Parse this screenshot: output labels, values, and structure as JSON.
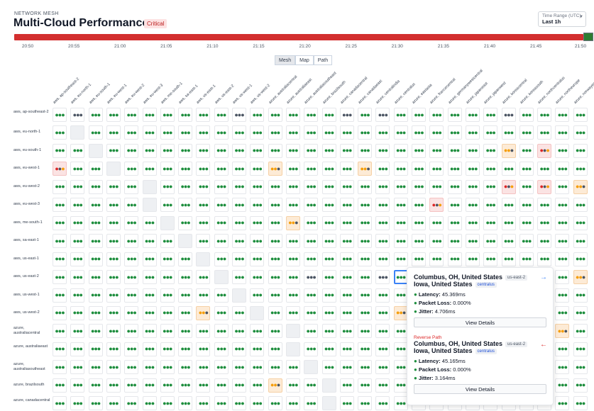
{
  "header": {
    "eyebrow": "NETWORK MESH",
    "title": "Multi-Cloud Performance",
    "status_badge": "Critical",
    "time_range_label": "Time Range (UTC)",
    "time_range_value": "Last 1h"
  },
  "colors": {
    "critical": "#d32f2f",
    "good": "#1e8e3e",
    "warn": "#f59e0b",
    "selected": "#3b82f6"
  },
  "timeline": {
    "ticks": [
      "20:50",
      "20:55",
      "21:00",
      "21:05",
      "21:10",
      "21:15",
      "21:20",
      "21:25",
      "21:30",
      "21:35",
      "21:40",
      "21:45",
      "21:50"
    ]
  },
  "view_tabs": [
    "Mesh",
    "Map",
    "Path"
  ],
  "active_view": "Mesh",
  "columns": [
    "aws, ap-southeast-2",
    "aws, eu-north-1",
    "aws, eu-south-1",
    "aws, eu-west-1",
    "aws, eu-west-2",
    "aws, eu-west-3",
    "aws, me-south-1",
    "aws, sa-east-1",
    "aws, us-east-1",
    "aws, us-east-2",
    "aws, us-west-1",
    "aws, us-west-2",
    "azure, australiacentral",
    "azure, australiaeast",
    "azure, australiasoutheast",
    "azure, brazilsouth",
    "azure, canadacentral",
    "azure, canadaeast",
    "azure, centralindia",
    "azure, centralus",
    "azure, eastasia",
    "azure, francecentral",
    "azure, germanywestcentral",
    "azure, japaneast",
    "azure, japanwest",
    "azure, koreacentral",
    "azure, koreasouth",
    "azure, northcentralus",
    "azure, northeurope",
    "azure, norwayeast"
  ],
  "rows": [
    "aws, ap-southeast-2",
    "aws, eu-north-1",
    "aws, eu-south-1",
    "aws, eu-west-1",
    "aws, eu-west-2",
    "aws, eu-west-3",
    "aws, me-south-1",
    "aws, sa-east-1",
    "aws, us-east-1",
    "aws, us-east-2",
    "aws, us-west-1",
    "aws, us-west-2",
    "azure, australiacentral",
    "azure, australiaeast",
    "azure, australiasoutheast",
    "azure, brazilsouth",
    "azure, canadacentral"
  ],
  "grid_status": [
    "gkggggggggkgggggkgkggggggkgggg",
    "gsgggggggggggggggggggggggggggg",
    "ggsggggggggggggggggggggggOgRgg",
    "RggsggggggggOggggOgggggggggggg",
    "gggggsgggggggggggggggggggRgRgO",
    "gggggsgggggggggggggggRgggggggg",
    "ggggggsggggggOgggggggggggggggg",
    "gggggggsgggggggggggggggggggggg",
    "ggggggggsggggggggggggggggggggg",
    "gggggggggsggggkgggkSgggggggggO",
    "ggggggggggsgggggggggggggggggg",
    "ggggggggOggsgggggggOggggggggg",
    "gggggggggggggsggggggggggggggOg",
    "gggggggggggggsgggggggggggggggg",
    "ggggggggggggggsggggggggggggggg",
    "ggggggggggggOggsgggggggggggggg",
    "gggggggggggggggsgggggggggggggg"
  ],
  "tooltip": {
    "forward": {
      "from": "Columbus, OH, United States",
      "from_tag": "us-east-2",
      "to": "Iowa, United States",
      "to_tag": "centralus",
      "latency": "45.369ms",
      "packet_loss": "0.000%",
      "jitter": "4.706ms"
    },
    "reverse_label": "Reverse Path",
    "reverse": {
      "from": "Columbus, OH, United States",
      "from_tag": "us-east-2",
      "to": "Iowa, United States",
      "to_tag": "centralus",
      "latency": "45.165ms",
      "packet_loss": "0.000%",
      "jitter": "3.164ms"
    },
    "latency_label": "Latency:",
    "packet_loss_label": "Packet Loss:",
    "jitter_label": "Jitter:",
    "view_details_label": "View Details"
  }
}
